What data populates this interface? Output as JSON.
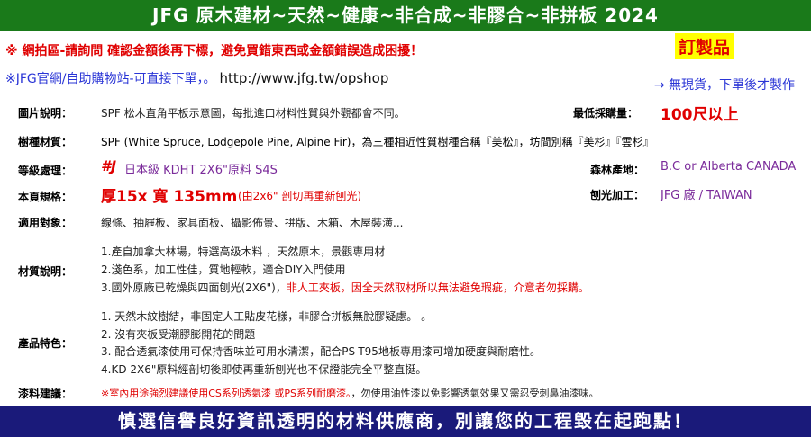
{
  "header": {
    "title": "JFG 原木建材~天然~健康~非合成~非膠合~非拼板 2024"
  },
  "notices": {
    "line1": "※ 網拍區-請詢問 確認金額後再下標，避免買錯東西或金額錯誤造成困擾！",
    "line2_prefix": "※",
    "line2_link": "JFG官網/自助購物站",
    "line2_text": "-可直接下單，。",
    "line2_url": "http://www.jfg.tw/opshop",
    "custom_badge": "訂製品",
    "no_stock": "→ 無現貨，下單後才製作"
  },
  "specs": {
    "image_label": "圖片說明：",
    "image_value": "SPF 松木直角平板示意圖，每批進口材料性質與外觀都會不同。",
    "min_order_label": "最低採購量：",
    "min_order_value": "100尺以上",
    "species_label": "樹種材質：",
    "species_value": "SPF (White Spruce, Lodgepole Pine, Alpine Fir)，為三種相近性質樹種合稱『美松』，坊間別稱『美杉』『雲杉』",
    "grade_label": "等級處理：",
    "grade_mark": "#J",
    "grade_value": "日本級 KDHT 2X6\"原料 S4S",
    "origin_label": "森林產地：",
    "origin_value": "B.C or Alberta CANADA",
    "size_label": "本頁規格：",
    "size_value": "厚15x 寬 135mm",
    "size_note": "(由2x6\" 剖切再重新刨光)",
    "plane_label": "刨光加工：",
    "plane_value": "JFG 廠 / TAIWAN",
    "use_label": "適用對象：",
    "use_value": "線條、抽屜板、家具面板、攝影佈景、拼版、木箱、木屋裝潢...",
    "material_label": "材質說明：",
    "material_lines": [
      "1.產自加拿大林場，特選高级木料 ，天然原木，景觀専用材",
      "2.淺色系，加工性佳，質地輕軟，適合DIY入門使用",
      "3.國外原廠已乾燥與四面刨光(2X6\")，"
    ],
    "material_line3_red": "非人工夾板，因全天然取材所以無法避免瑕疵，介意者勿採購。",
    "feature_label": "產品特色：",
    "feature_lines": [
      "1. 天然木紋樹結，非固定人工貼皮花樣，非膠合拼板無脫膠疑慮。 。",
      "2. 沒有夾板受潮膠膨開花的問題",
      "3. 配合透氣漆使用可保持香味並可用水清潔，配合PS-T95地板専用漆可增加硬度與耐磨性。"
    ],
    "feature_line4": "4.KD 2X6\"原料經剖切後即使再重新刨光也不保證能完全平整直挺。",
    "paint_label": "漆料建議：",
    "paint_value_red": "※室內用途強烈建議使用CS系列透氣漆 或PS系列耐磨漆。",
    "paint_value_rest": "，勿使用油性漆以免影響透氣效果又需忍受刺鼻油漆味。"
  },
  "footer": {
    "slogan": "慎選信譽良好資訊透明的材料供應商，別讓您的工程毀在起跑點！"
  },
  "colors": {
    "top_bar": "#1a7a1a",
    "bottom_bar": "#1a1a7a",
    "accent_red": "#e00000",
    "accent_blue": "#2a35d6",
    "badge_bg": "#ffff00"
  }
}
